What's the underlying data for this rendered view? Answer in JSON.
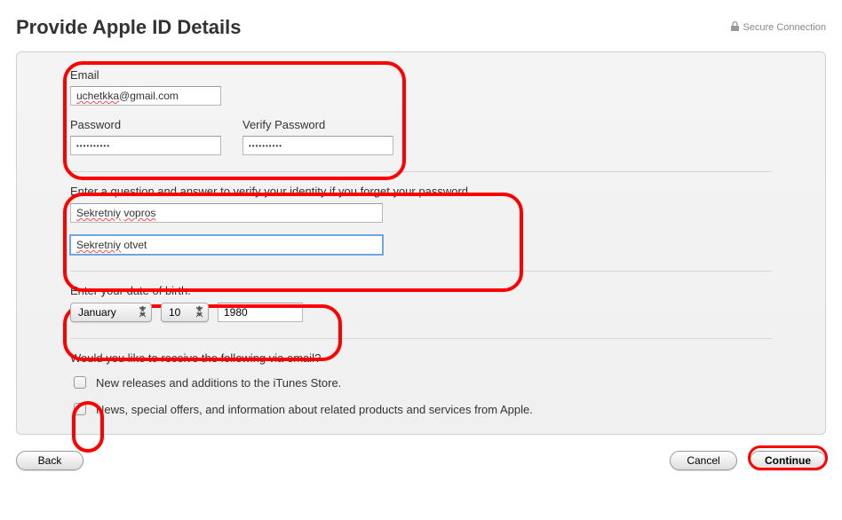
{
  "header": {
    "title": "Provide Apple ID Details",
    "secure_label": "Secure Connection"
  },
  "credentials": {
    "email_label": "Email",
    "email_value": "uchetkka@gmail.com",
    "password_label": "Password",
    "password_value": "••••••••••",
    "verify_label": "Verify Password",
    "verify_value": "••••••••••"
  },
  "security": {
    "prompt": "Enter a question and answer to verify your identity if you forget your password.",
    "question_value": "Sekretniy vopros",
    "answer_value": "Sekretniy otvet"
  },
  "dob": {
    "prompt": "Enter your date of birth.",
    "month_value": "January",
    "day_value": "10",
    "year_value": "1980"
  },
  "emailprefs": {
    "prompt": "Would you like to receive the following via email?",
    "opt1": "New releases and additions to the iTunes Store.",
    "opt2": "News, special offers, and information about related products and services from Apple."
  },
  "footer": {
    "back": "Back",
    "cancel": "Cancel",
    "continue": "Continue"
  }
}
